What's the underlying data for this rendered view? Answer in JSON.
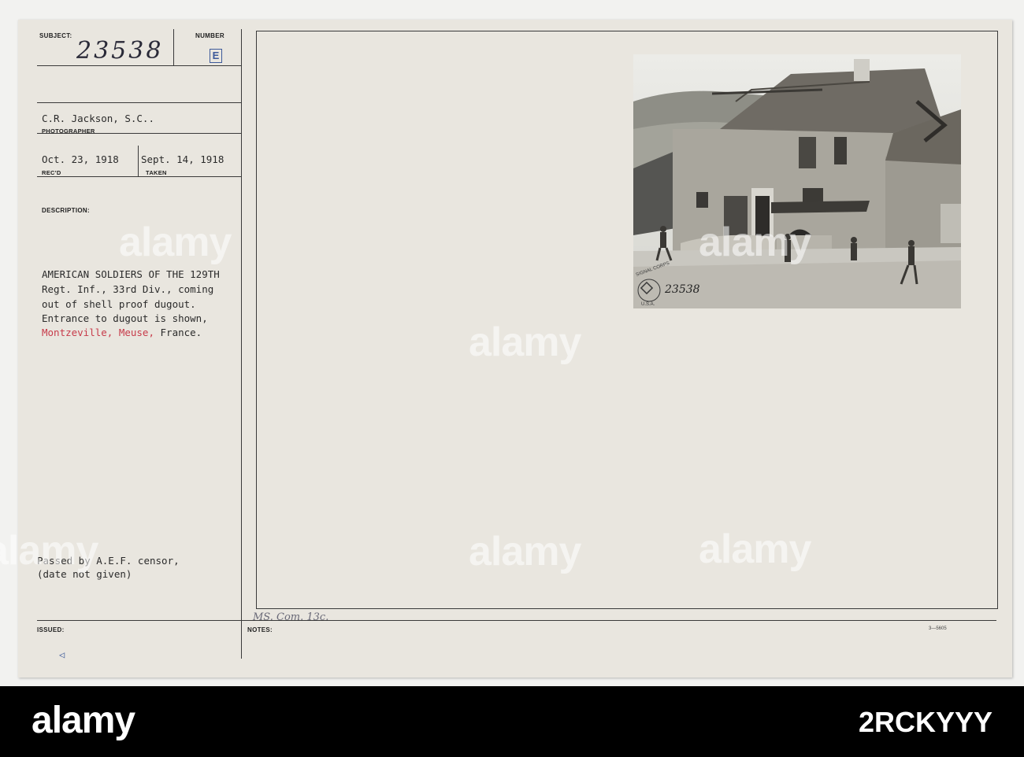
{
  "card": {
    "subject_label": "SUBJECT:",
    "subject_handwritten": "23538",
    "number_label": "NUMBER",
    "number_stamp": "E",
    "photographer_name": "C.R. Jackson, S.C..",
    "photographer_label": "PHOTOGRAPHER",
    "received_date": "Oct. 23, 1918",
    "received_label": "REC'D",
    "taken_date": "Sept. 14, 1918",
    "taken_label": "TAKEN",
    "description_label": "DESCRIPTION:",
    "description_line1": "AMERICAN SOLDIERS OF THE 129TH",
    "description_line2": "Regt. Inf., 33rd Div., coming",
    "description_line3": "out of shell proof dugout.",
    "description_line4": "Entrance to dugout is shown,",
    "description_place": "Montzeville, Meuse,",
    "description_country": "France.",
    "censor_line1": "Passed by A.E.F. censor,",
    "censor_line2": "(date not given)",
    "issued_label": "ISSUED:",
    "notes_label": "NOTES:",
    "notes_handwritten": "MS. Com. 13c.",
    "form_number": "3—5605",
    "issued_mark": "◁"
  },
  "photo": {
    "stamp_text": "SIGNAL CORPS U.S.A.",
    "photo_number": "23538"
  },
  "watermark": {
    "text": "alamy"
  },
  "footer": {
    "logo": "alamy",
    "image_id": "2RCKYYY"
  },
  "colors": {
    "card": "#e9e6df",
    "background": "#f2f2f0",
    "place_red": "#c73b4a",
    "stamp_blue": "#3d5a9a",
    "band": "#000000"
  }
}
